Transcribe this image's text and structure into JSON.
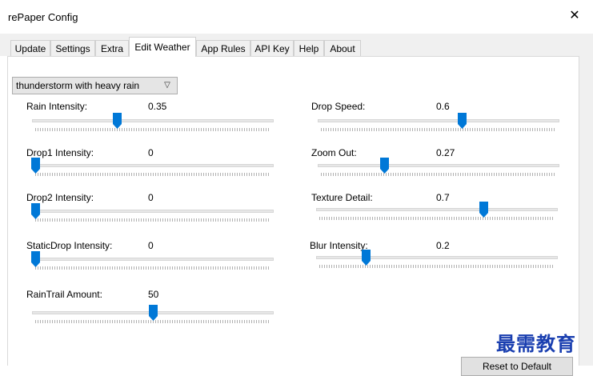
{
  "window": {
    "title": "rePaper Config",
    "close_glyph": "✕"
  },
  "tabs": [
    {
      "label": "Update"
    },
    {
      "label": "Settings"
    },
    {
      "label": "Extra"
    },
    {
      "label": "Edit Weather",
      "active": true
    },
    {
      "label": "App Rules"
    },
    {
      "label": "API Key"
    },
    {
      "label": "Help"
    },
    {
      "label": "About"
    }
  ],
  "weather_select": {
    "value": "thunderstorm with heavy rain",
    "icon": "chevron-down-icon"
  },
  "sliders_left": [
    {
      "label": "Rain Intensity:",
      "value": "0.35",
      "level": 0.35
    },
    {
      "label": "Drop1 Intensity:",
      "value": "0",
      "level": 0
    },
    {
      "label": "Drop2 Intensity:",
      "value": "0",
      "level": 0
    },
    {
      "label": "StaticDrop Intensity:",
      "value": "0",
      "level": 0
    },
    {
      "label": "RainTrail Amount:",
      "value": "50",
      "level": 0.5
    }
  ],
  "sliders_right": [
    {
      "label": "Drop Speed:",
      "value": "0.6",
      "level": 0.6
    },
    {
      "label": "Zoom Out:",
      "value": "0.27",
      "level": 0.27
    },
    {
      "label": "Texture Detail:",
      "value": "0.7",
      "level": 0.7
    },
    {
      "label": "Blur Intensity:",
      "value": "0.2",
      "level": 0.2
    }
  ],
  "reset_button": {
    "label": "Reset to Default"
  },
  "watermark": {
    "text": "最需教育"
  },
  "colors": {
    "thumb": "#0078d7",
    "accent_text": "#1a3fb0"
  }
}
